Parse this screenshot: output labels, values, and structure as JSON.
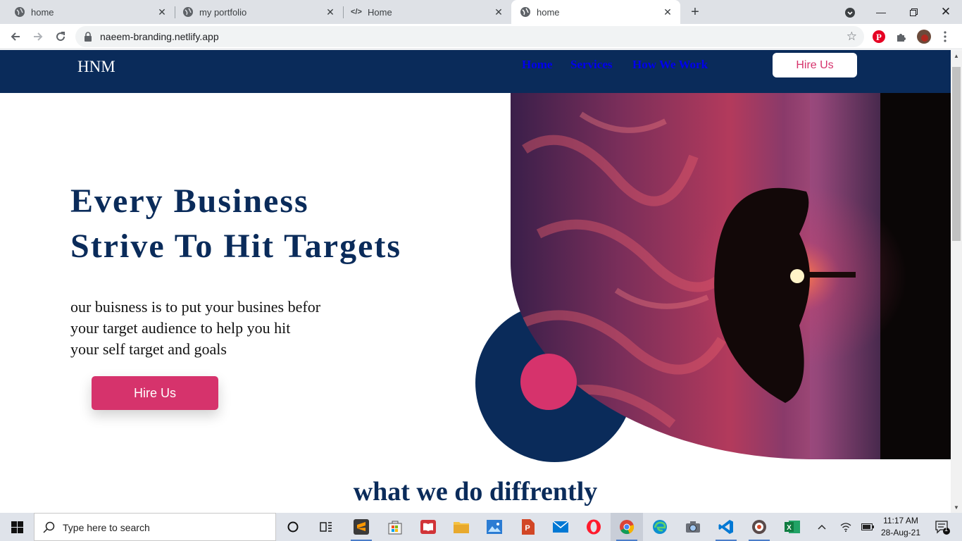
{
  "browser": {
    "tabs": [
      {
        "title": "home",
        "icon": "globe-icon",
        "active": false
      },
      {
        "title": "my portfolio",
        "icon": "globe-icon",
        "active": false
      },
      {
        "title": "Home",
        "icon": "code-icon",
        "active": false
      },
      {
        "title": "home",
        "icon": "globe-icon",
        "active": true
      }
    ],
    "url": "naeem-branding.netlify.app"
  },
  "site": {
    "logo": "HNM",
    "nav": [
      "Home",
      "Services",
      "How We Work"
    ],
    "hire_top": "Hire Us",
    "hero_line1": "Every Business",
    "hero_line2": "Strive To Hit Targets",
    "hero_text_1": "our buisness is to put your busines befor",
    "hero_text_2": "your target audience to help you hit",
    "hero_text_3": "your self target and goals",
    "hire_main": "Hire Us",
    "section_title": "what we do diffrently",
    "colors": {
      "navy": "#0a2b5a",
      "pink": "#d6336c"
    }
  },
  "taskbar": {
    "search_placeholder": "Type here to search",
    "time": "11:17 AM",
    "date": "28-Aug-21",
    "notification_count": "1",
    "apps": [
      "cortana-icon",
      "task-view-icon",
      "sublime-text-icon",
      "microsoft-store-icon",
      "reader-icon",
      "file-explorer-icon",
      "photos-icon",
      "powerpoint-icon",
      "mail-icon",
      "opera-icon",
      "chrome-icon",
      "edge-icon",
      "camera-icon",
      "vscode-icon",
      "media-icon",
      "excel-icon"
    ]
  }
}
